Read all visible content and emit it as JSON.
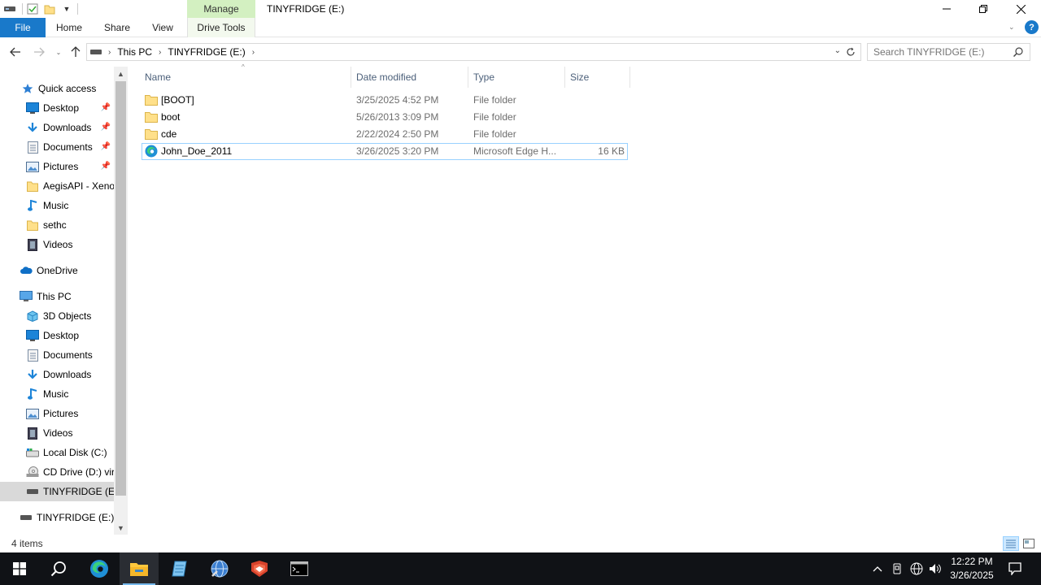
{
  "window": {
    "title": "TINYFRIDGE (E:)",
    "contextual_tab": "Manage"
  },
  "ribbon": {
    "tabs": [
      {
        "label": "File"
      },
      {
        "label": "Home"
      },
      {
        "label": "Share"
      },
      {
        "label": "View"
      },
      {
        "label": "Drive Tools"
      }
    ]
  },
  "address": {
    "crumbs": [
      "This PC",
      "TINYFRIDGE (E:)"
    ]
  },
  "search": {
    "placeholder": "Search TINYFRIDGE (E:)"
  },
  "nav": {
    "quick_access": "Quick access",
    "quick_items": [
      {
        "label": "Desktop",
        "icon": "desktop-icon",
        "pinned": true
      },
      {
        "label": "Downloads",
        "icon": "downloads-icon",
        "pinned": true
      },
      {
        "label": "Documents",
        "icon": "documents-icon",
        "pinned": true
      },
      {
        "label": "Pictures",
        "icon": "pictures-icon",
        "pinned": true
      },
      {
        "label": "AegisAPI - Xeno",
        "icon": "folder-icon",
        "pinned": false
      },
      {
        "label": "Music",
        "icon": "music-icon",
        "pinned": false
      },
      {
        "label": "sethc",
        "icon": "folder-icon",
        "pinned": false
      },
      {
        "label": "Videos",
        "icon": "videos-icon",
        "pinned": false
      }
    ],
    "onedrive": "OneDrive",
    "this_pc": "This PC",
    "pc_items": [
      {
        "label": "3D Objects",
        "icon": "3d-objects-icon"
      },
      {
        "label": "Desktop",
        "icon": "desktop-icon"
      },
      {
        "label": "Documents",
        "icon": "documents-icon"
      },
      {
        "label": "Downloads",
        "icon": "downloads-icon"
      },
      {
        "label": "Music",
        "icon": "music-icon"
      },
      {
        "label": "Pictures",
        "icon": "pictures-icon"
      },
      {
        "label": "Videos",
        "icon": "videos-icon"
      },
      {
        "label": "Local Disk (C:)",
        "icon": "local-disk-icon"
      },
      {
        "label": "CD Drive (D:) virt",
        "icon": "cd-drive-icon"
      },
      {
        "label": "TINYFRIDGE (E:)",
        "icon": "usb-drive-icon"
      }
    ],
    "removable": "TINYFRIDGE (E:)"
  },
  "columns": {
    "name": "Name",
    "date": "Date modified",
    "type": "Type",
    "size": "Size"
  },
  "files": [
    {
      "name": "[BOOT]",
      "date": "3/25/2025 4:52 PM",
      "type": "File folder",
      "size": "",
      "icon": "folder-icon"
    },
    {
      "name": "boot",
      "date": "5/26/2013 3:09 PM",
      "type": "File folder",
      "size": "",
      "icon": "folder-icon"
    },
    {
      "name": "cde",
      "date": "2/22/2024 2:50 PM",
      "type": "File folder",
      "size": "",
      "icon": "folder-icon"
    },
    {
      "name": "John_Doe_2011",
      "date": "3/26/2025 3:20 PM",
      "type": "Microsoft Edge H...",
      "size": "16 KB",
      "icon": "edge-html-icon"
    }
  ],
  "status": {
    "item_count": "4 items"
  },
  "taskbar": {
    "time": "12:22 PM",
    "date": "3/26/2025"
  },
  "colors": {
    "accent": "#1979ca",
    "manage_tab": "#d3f0c1",
    "selection_border": "#99d1ff",
    "taskbar": "#101216"
  }
}
